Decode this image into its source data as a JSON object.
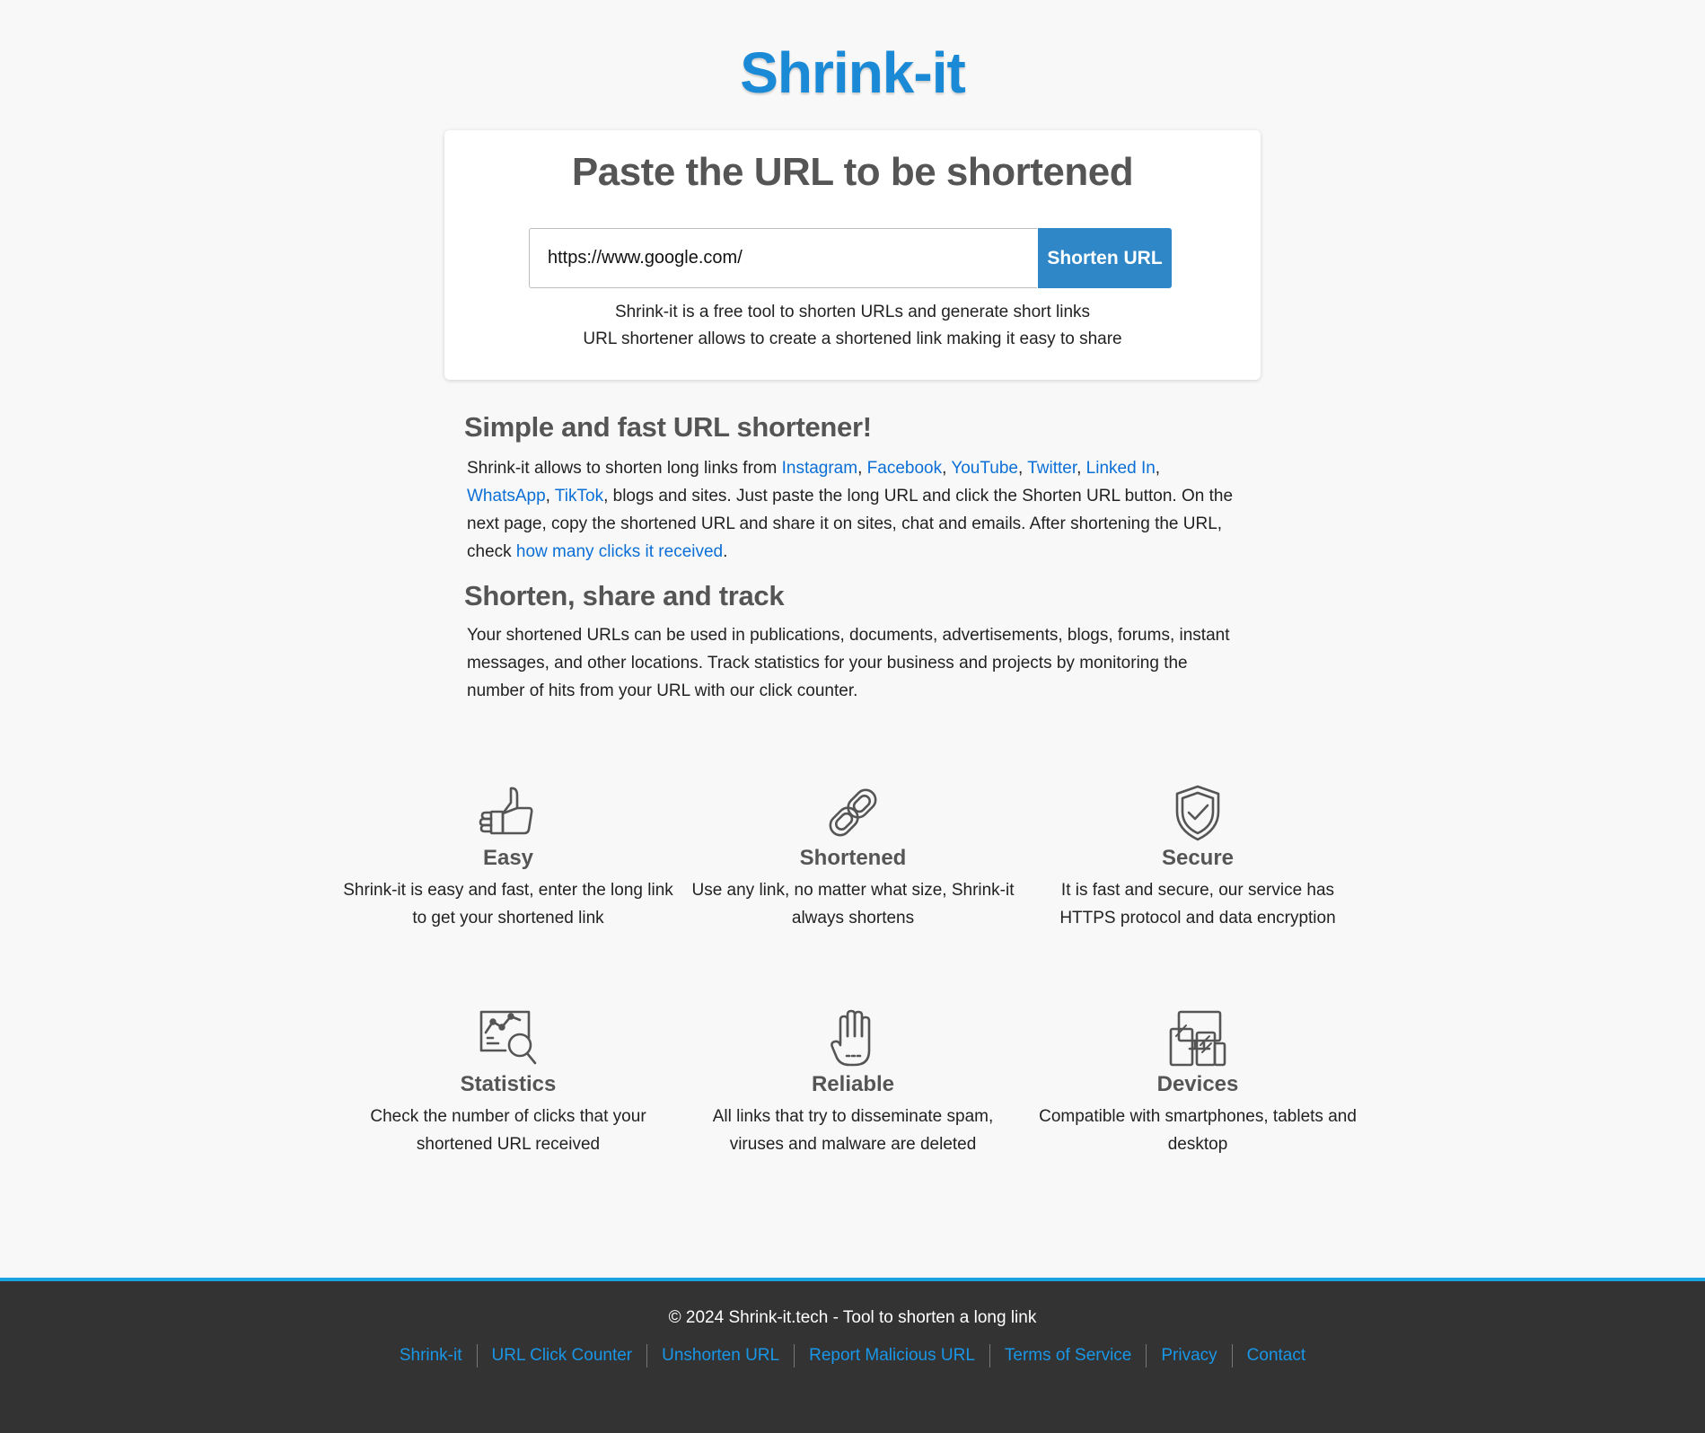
{
  "logo": {
    "text": "Shrink-it",
    "color": "#1a8ad6"
  },
  "card": {
    "title": "Paste the URL to be shortened",
    "input_value": "https://www.google.com/",
    "button_label": "Shorten URL",
    "button_color": "#2f87c7",
    "desc_line1": "Shrink-it is a free tool to shorten URLs and generate short links",
    "desc_line2": "URL shortener allows to create a shortened link making it easy to share"
  },
  "intro": {
    "heading": "Simple and fast URL shortener!",
    "text_start": "Shrink-it allows to shorten long links from ",
    "links": [
      "Instagram",
      "Facebook",
      "YouTube",
      "Twitter",
      "Linked In",
      "WhatsApp",
      "TikTok"
    ],
    "sep": ", ",
    "text_middle": ", blogs and sites. Just paste the long URL and click the Shorten URL button. On the next page, copy the shortened URL and share it on sites, chat and emails. After shortening the URL, check ",
    "clicks_link": "how many clicks it received",
    "text_end": "."
  },
  "share": {
    "heading": "Shorten, share and track",
    "text": "Your shortened URLs can be used in publications, documents, advertisements, blogs, forums, instant messages, and other locations. Track statistics for your business and projects by monitoring the number of hits from your URL with our click counter."
  },
  "features": [
    {
      "title": "Easy",
      "desc": "Shrink-it is easy and fast, enter the long link to get your shortened link",
      "icon": "thumbs-up-icon"
    },
    {
      "title": "Shortened",
      "desc": "Use any link, no matter what size, Shrink-it always shortens",
      "icon": "chain-link-icon"
    },
    {
      "title": "Secure",
      "desc": "It is fast and secure, our service has HTTPS protocol and data encryption",
      "icon": "shield-check-icon"
    },
    {
      "title": "Statistics",
      "desc": "Check the number of clicks that your shortened URL received",
      "icon": "chart-magnifier-icon"
    },
    {
      "title": "Reliable",
      "desc": "All links that try to disseminate spam, viruses and malware are deleted",
      "icon": "hand-stop-icon"
    },
    {
      "title": "Devices",
      "desc": "Compatible with smartphones, tablets and desktop",
      "icon": "devices-icon"
    }
  ],
  "footer": {
    "copyright": "© 2024 Shrink-it.tech - Tool to shorten a long link",
    "links": [
      "Shrink-it",
      "URL Click Counter",
      "Unshorten URL",
      "Report Malicious URL",
      "Terms of Service",
      "Privacy",
      "Contact"
    ],
    "accent_color": "#1aa3e0",
    "background": "#333333"
  }
}
